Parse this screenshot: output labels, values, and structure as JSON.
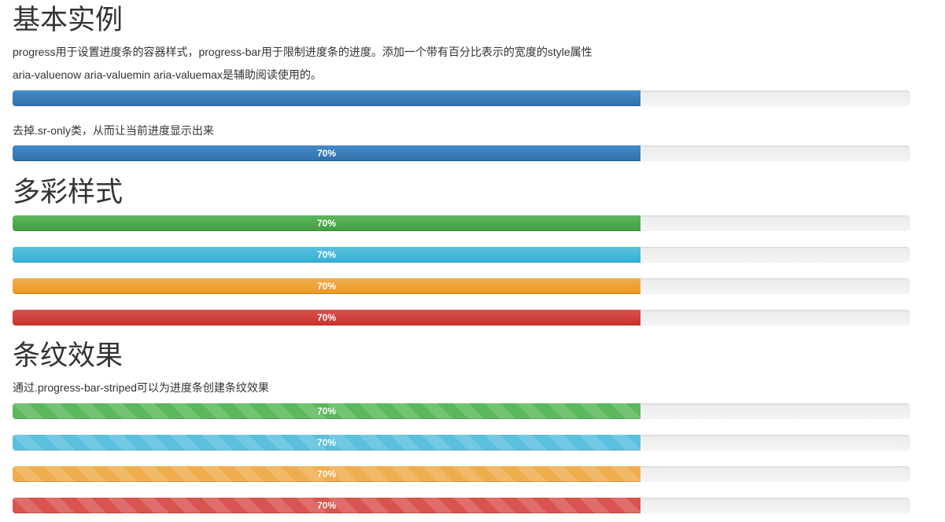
{
  "basic": {
    "title": "基本实例",
    "desc1": "progress用于设置进度条的容器样式，progress-bar用于限制进度条的进度。添加一个带有百分比表示的宽度的style属性",
    "desc2": "aria-valuenow aria-valuemin aria-valuemax是辅助阅读使用的。",
    "bar1": {
      "value": 70,
      "label": ""
    },
    "desc3": "去掉.sr-only类，从而让当前进度显示出来",
    "bar2": {
      "value": 70,
      "label": "70%"
    }
  },
  "colorful": {
    "title": "多彩样式",
    "bars": [
      {
        "variant": "success",
        "value": 70,
        "label": "70%"
      },
      {
        "variant": "info",
        "value": 70,
        "label": "70%"
      },
      {
        "variant": "warning",
        "value": 70,
        "label": "70%"
      },
      {
        "variant": "danger",
        "value": 70,
        "label": "70%"
      }
    ]
  },
  "striped": {
    "title": "条纹效果",
    "desc": "通过.progress-bar-striped可以为进度条创建条纹效果",
    "bars": [
      {
        "variant": "success",
        "value": 70,
        "label": "70%"
      },
      {
        "variant": "info",
        "value": 70,
        "label": "70%"
      },
      {
        "variant": "warning",
        "value": 70,
        "label": "70%"
      },
      {
        "variant": "danger",
        "value": 70,
        "label": "70%"
      }
    ]
  },
  "colors": {
    "primary": "#428bca",
    "success": "#5cb85c",
    "info": "#5bc0de",
    "warning": "#f0ad4e",
    "danger": "#d9534f",
    "track": "#f5f5f5"
  }
}
